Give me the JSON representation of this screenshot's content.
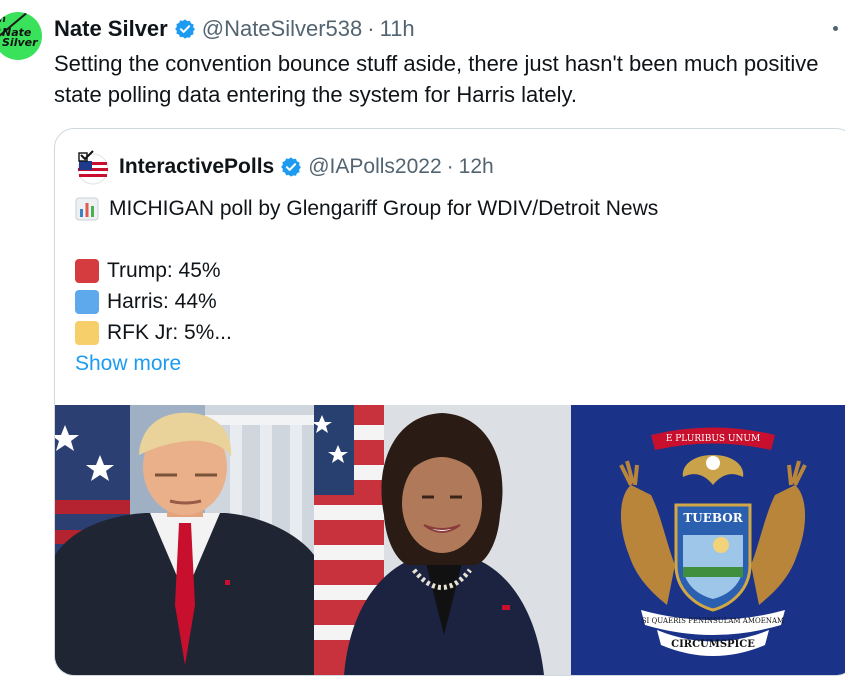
{
  "tweet": {
    "avatar_text": "the Nate Silver",
    "display_name": "Nate Silver",
    "handle": "@NateSilver538",
    "separator": "·",
    "time": "11h",
    "text": "Setting the convention bounce stuff aside, there just hasn't been much positive state polling data entering the system for Harris lately."
  },
  "quote": {
    "display_name": "InteractivePolls",
    "handle": "@IAPolls2022",
    "separator": "·",
    "time": "12h",
    "headline": "MICHIGAN poll by Glengariff Group for WDIV/Detroit News",
    "results": [
      {
        "label": "Trump: 45%",
        "color": "#d43c3f"
      },
      {
        "label": "Harris: 44%",
        "color": "#5ea8ec"
      },
      {
        "label": "RFK Jr: 5%...",
        "color": "#f7cf6a"
      }
    ],
    "show_more": "Show more",
    "seal_text_top": "E PLURIBUS UNUM",
    "seal_text_shield": "TUEBOR",
    "seal_text_bottom": "SI QUAERIS PENINSULAM AMOENAM",
    "seal_text_circ": "CIRCUMSPICE"
  },
  "colors": {
    "verified": "#1d9bf0",
    "link": "#1d9bf0",
    "secondary_text": "#536471",
    "border": "#cfd9de",
    "michigan_blue": "#1a3389"
  },
  "icons": {
    "verified": "verified-badge-icon",
    "more": "more-options-icon",
    "chart": "bar-chart-emoji-icon"
  }
}
